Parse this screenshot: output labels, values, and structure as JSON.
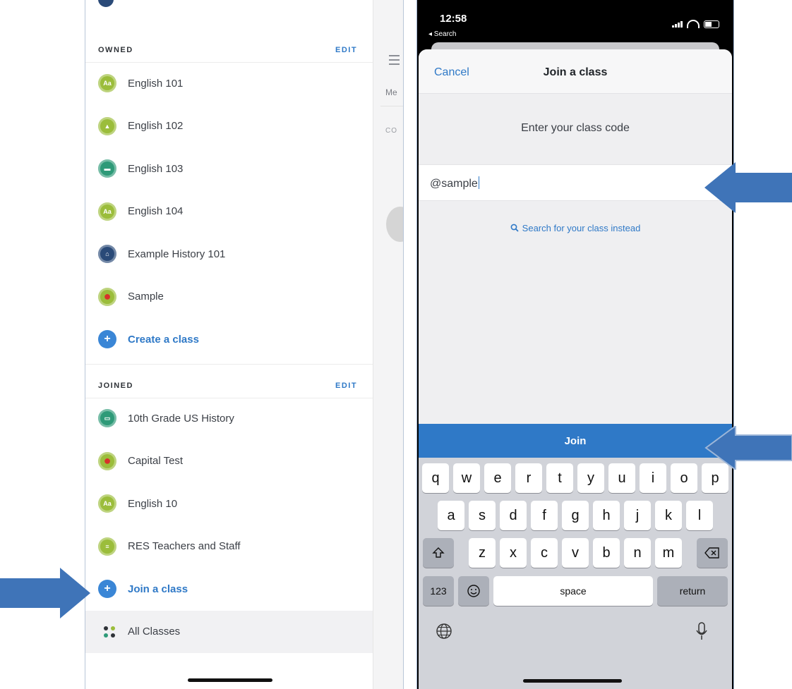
{
  "left_screen": {
    "owned_header": "OWNED",
    "owned_edit": "EDIT",
    "owned_classes": [
      {
        "label": "English 101",
        "icon": "book-icon",
        "color": "#9bbd3b"
      },
      {
        "label": "English 102",
        "icon": "flask-icon",
        "color": "#9bbd3b"
      },
      {
        "label": "English 103",
        "icon": "computer-icon",
        "color": "#2e9a78"
      },
      {
        "label": "English 104",
        "icon": "book-icon",
        "color": "#9bbd3b"
      },
      {
        "label": "Example History 101",
        "icon": "building-icon",
        "color": "#2a4a78"
      },
      {
        "label": "Sample",
        "icon": "apple-icon",
        "color": "#9bbd3b"
      }
    ],
    "create_label": "Create a class",
    "joined_header": "JOINED",
    "joined_edit": "EDIT",
    "joined_classes": [
      {
        "label": "10th Grade US History",
        "icon": "folder-icon",
        "color": "#2e9a78"
      },
      {
        "label": "Capital Test",
        "icon": "apple-icon",
        "color": "#9bbd3b"
      },
      {
        "label": "English 10",
        "icon": "book-icon",
        "color": "#9bbd3b"
      },
      {
        "label": "RES Teachers and Staff",
        "icon": "burger-icon",
        "color": "#9bbd3b"
      }
    ],
    "join_label": "Join a class",
    "all_classes_label": "All Classes",
    "behind_mer": "Me",
    "behind_con": "CO"
  },
  "right_screen": {
    "status_time": "12:58",
    "status_back": "◂ Search",
    "nav_cancel": "Cancel",
    "nav_title": "Join a class",
    "prompt": "Enter your class code",
    "code_value": "@sample",
    "search_link": "Search for your class instead",
    "join_button": "Join",
    "keyboard": {
      "row1": [
        "q",
        "w",
        "e",
        "r",
        "t",
        "y",
        "u",
        "i",
        "o",
        "p"
      ],
      "row2": [
        "a",
        "s",
        "d",
        "f",
        "g",
        "h",
        "j",
        "k",
        "l"
      ],
      "row3": [
        "z",
        "x",
        "c",
        "v",
        "b",
        "n",
        "m"
      ],
      "key_123": "123",
      "key_space": "space",
      "key_return": "return"
    }
  },
  "colors": {
    "accent_blue": "#2f79c7",
    "arrow_blue": "#3f74b8"
  }
}
